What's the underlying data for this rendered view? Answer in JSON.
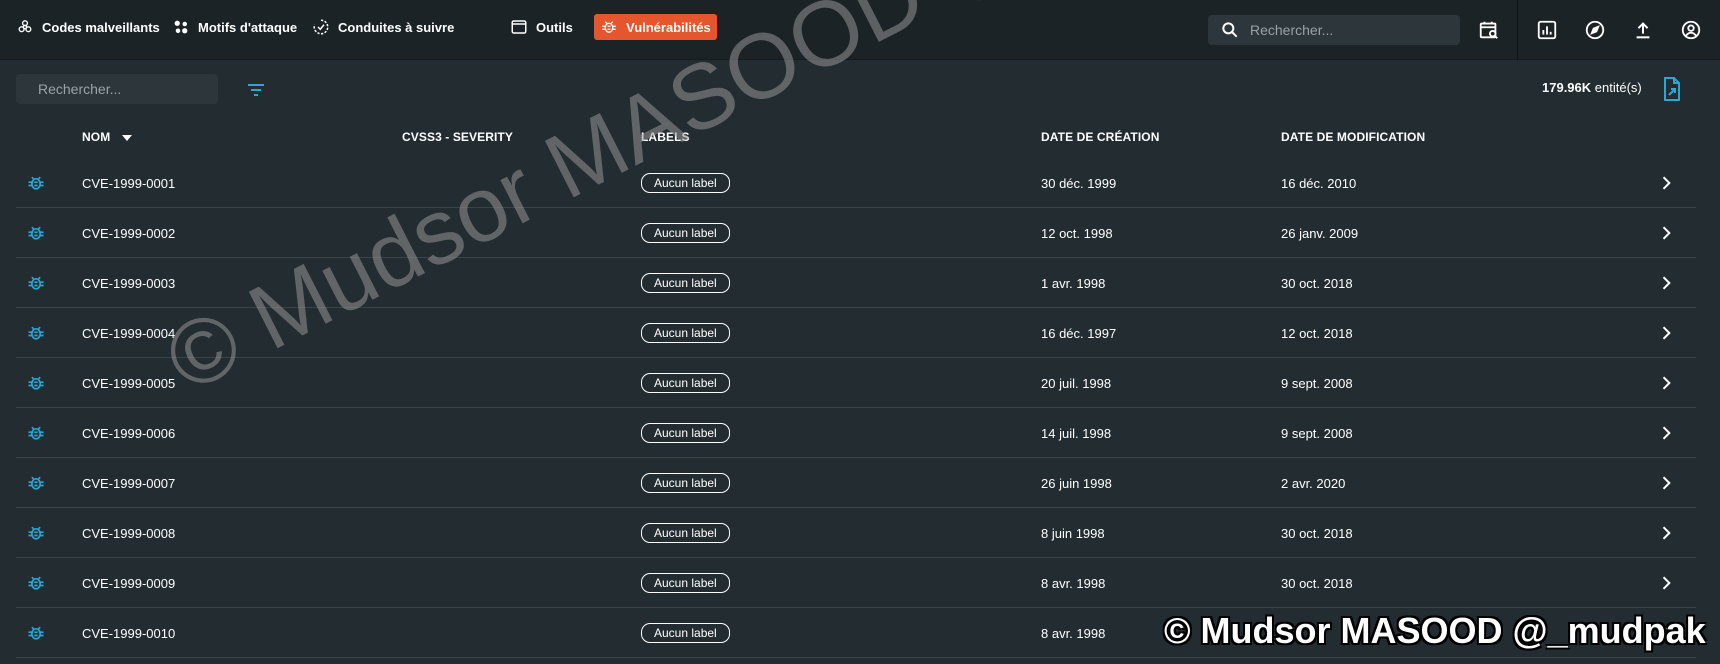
{
  "colors": {
    "background": "#222c31",
    "topbar": "#1b2326",
    "accent_active_tab": "#e4572e",
    "icon_accent": "#2aa8d4"
  },
  "nav": {
    "tabs": [
      {
        "label": "Codes malveillants",
        "icon": "biohazard-icon"
      },
      {
        "label": "Motifs d'attaque",
        "icon": "attack-pattern-icon"
      },
      {
        "label": "Conduites à suivre",
        "icon": "progress-check-icon"
      },
      {
        "label": "Outils",
        "icon": "window-icon"
      },
      {
        "label": "Vulnérabilités",
        "icon": "bug-icon"
      }
    ],
    "active_tab": "Vulnérabilités",
    "search_placeholder": "Rechercher...",
    "icons": [
      "calendar-search-icon",
      "dashboard-chart-icon",
      "compass-icon",
      "upload-icon",
      "account-icon"
    ]
  },
  "toolbar": {
    "search_placeholder": "Rechercher...",
    "entity_count_value": "179.96K",
    "entity_count_label": " entité(s)"
  },
  "table": {
    "columns": {
      "name": "Nom",
      "severity": "CVSS3 - Severity",
      "labels": "Labels",
      "created": "Date de création",
      "modified": "Date de modification"
    },
    "rows": [
      {
        "name": "CVE-1999-0001",
        "labels": "Aucun label",
        "created": "30 déc. 1999",
        "modified": "16 déc. 2010"
      },
      {
        "name": "CVE-1999-0002",
        "labels": "Aucun label",
        "created": "12 oct. 1998",
        "modified": "26 janv. 2009"
      },
      {
        "name": "CVE-1999-0003",
        "labels": "Aucun label",
        "created": "1 avr. 1998",
        "modified": "30 oct. 2018"
      },
      {
        "name": "CVE-1999-0004",
        "labels": "Aucun label",
        "created": "16 déc. 1997",
        "modified": "12 oct. 2018"
      },
      {
        "name": "CVE-1999-0005",
        "labels": "Aucun label",
        "created": "20 juil. 1998",
        "modified": "9 sept. 2008"
      },
      {
        "name": "CVE-1999-0006",
        "labels": "Aucun label",
        "created": "14 juil. 1998",
        "modified": "9 sept. 2008"
      },
      {
        "name": "CVE-1999-0007",
        "labels": "Aucun label",
        "created": "26 juin 1998",
        "modified": "2 avr. 2020"
      },
      {
        "name": "CVE-1999-0008",
        "labels": "Aucun label",
        "created": "8 juin 1998",
        "modified": "30 oct. 2018"
      },
      {
        "name": "CVE-1999-0009",
        "labels": "Aucun label",
        "created": "8 avr. 1998",
        "modified": "30 oct. 2018"
      },
      {
        "name": "CVE-1999-0010",
        "labels": "Aucun label",
        "created": "8 avr. 1998",
        "modified": ""
      }
    ]
  },
  "watermark": {
    "diagonal": "© Mudsor MASOOD @_mudpak",
    "corner": "© Mudsor MASOOD @_mudpak"
  }
}
